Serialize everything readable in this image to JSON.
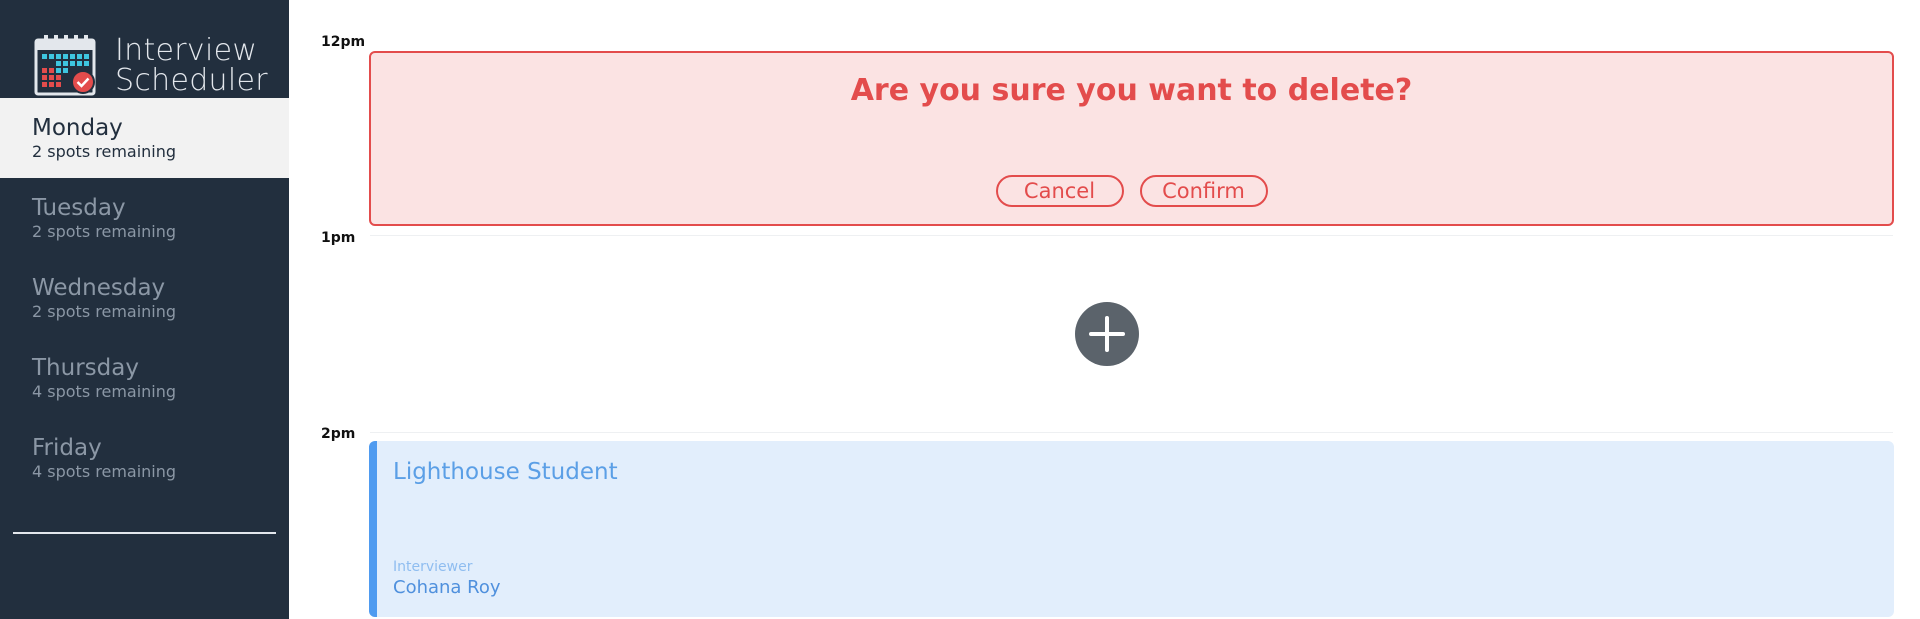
{
  "app": {
    "title_line1": "Interview",
    "title_line2": "Scheduler"
  },
  "days": [
    {
      "name": "Monday",
      "spots": "2 spots remaining",
      "selected": true
    },
    {
      "name": "Tuesday",
      "spots": "2 spots remaining",
      "selected": false
    },
    {
      "name": "Wednesday",
      "spots": "2 spots remaining",
      "selected": false
    },
    {
      "name": "Thursday",
      "spots": "4 spots remaining",
      "selected": false
    },
    {
      "name": "Friday",
      "spots": "4 spots remaining",
      "selected": false
    }
  ],
  "times": [
    "12pm",
    "1pm",
    "2pm"
  ],
  "confirm": {
    "message": "Are you sure you want to delete?",
    "cancel_label": "Cancel",
    "confirm_label": "Confirm"
  },
  "add_slot": {
    "icon": "plus-icon"
  },
  "appointment": {
    "student": "Lighthouse Student",
    "interviewer_label": "Interviewer",
    "interviewer_name": "Cohana Roy"
  },
  "colors": {
    "sidebar_bg": "#222f3e",
    "danger": "#e34c4c",
    "danger_bg": "#fbe3e3",
    "accent": "#4f9bf0",
    "appointment_bg": "#e2eefc"
  }
}
